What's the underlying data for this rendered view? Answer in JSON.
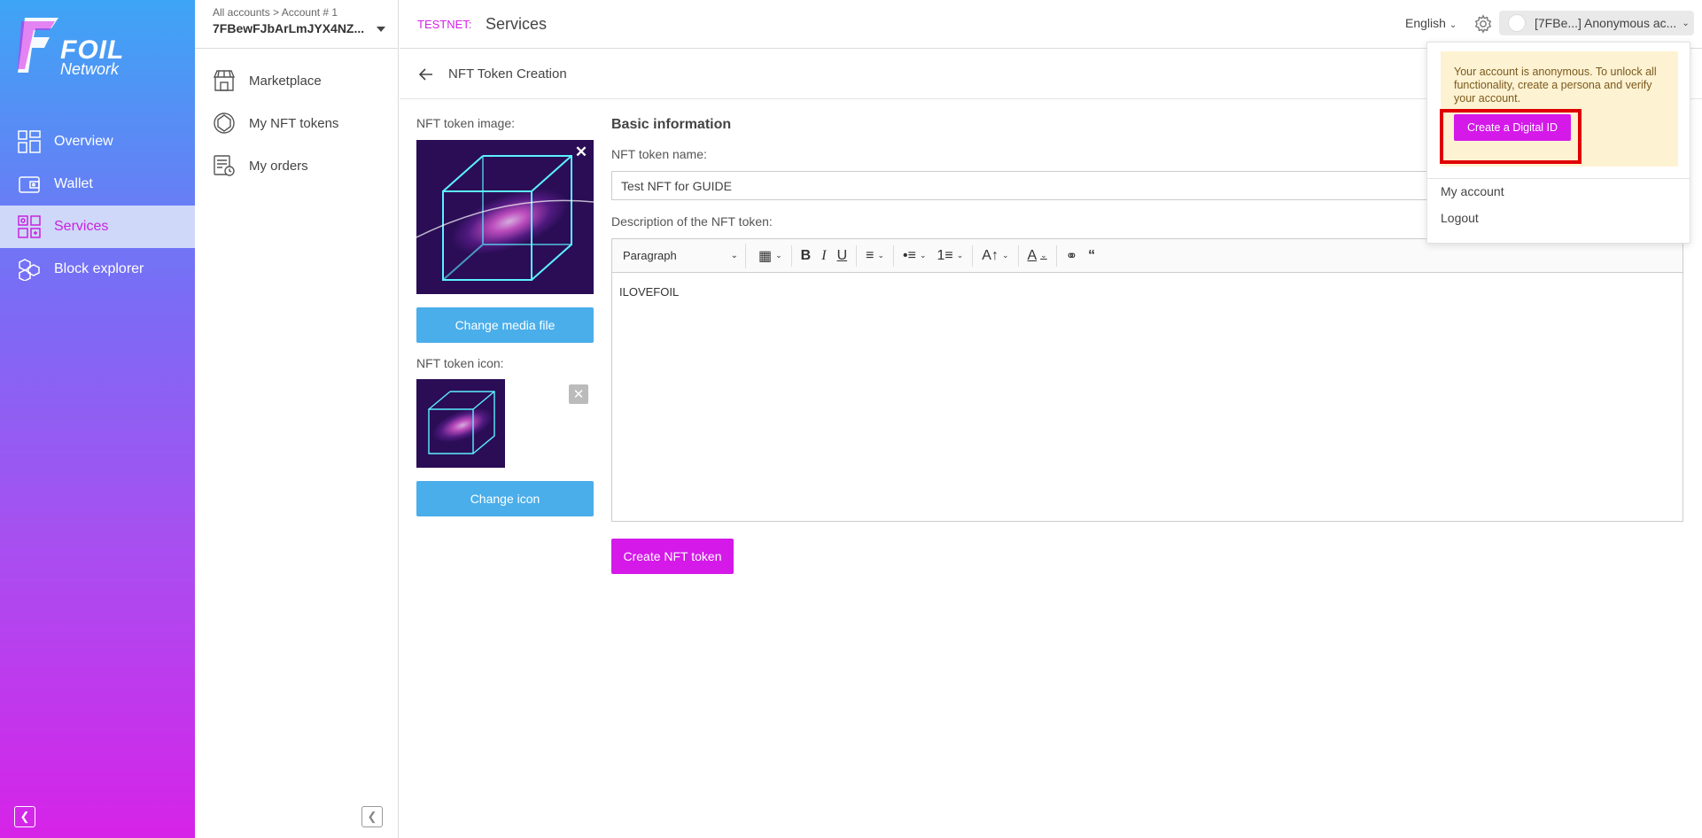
{
  "brand": {
    "word": "FOIL",
    "sub": "Network"
  },
  "main_nav": [
    {
      "label": "Overview",
      "icon": "overview-icon"
    },
    {
      "label": "Wallet",
      "icon": "wallet-icon"
    },
    {
      "label": "Services",
      "icon": "services-icon",
      "active": true
    },
    {
      "label": "Block explorer",
      "icon": "block-explorer-icon"
    }
  ],
  "account": {
    "breadcrumb": "All accounts > Account # 1",
    "id": "7FBewFJbArLmJYX4NZ..."
  },
  "sub_nav": [
    {
      "label": "Marketplace",
      "icon": "marketplace-icon"
    },
    {
      "label": "My NFT tokens",
      "icon": "nft-tokens-icon"
    },
    {
      "label": "My orders",
      "icon": "orders-icon"
    }
  ],
  "header": {
    "network": "TESTNET:",
    "title": "Services",
    "language": "English",
    "account_label": "[7FBe...] Anonymous ac..."
  },
  "page": {
    "title": "NFT Token Creation",
    "image_label": "NFT token image:",
    "change_media": "Change media file",
    "icon_label": "NFT token icon:",
    "change_icon": "Change icon",
    "section_title": "Basic information",
    "name_label": "NFT token name:",
    "name_value": "Test NFT for GUIDE",
    "desc_label": "Description of the NFT token:",
    "editor_format": "Paragraph",
    "desc_value": "ILOVEFOIL",
    "create_button": "Create NFT token"
  },
  "dropdown": {
    "notice": "Your account is anonymous. To unlock all functionality, create a persona and verify your account.",
    "digital_id_button": "Create a Digital ID",
    "my_account": "My account",
    "logout": "Logout"
  },
  "colors": {
    "accent": "#d419e9",
    "blue_button": "#4aaeea",
    "active_nav_bg": "#cfd8f9",
    "highlight": "#e00000"
  }
}
